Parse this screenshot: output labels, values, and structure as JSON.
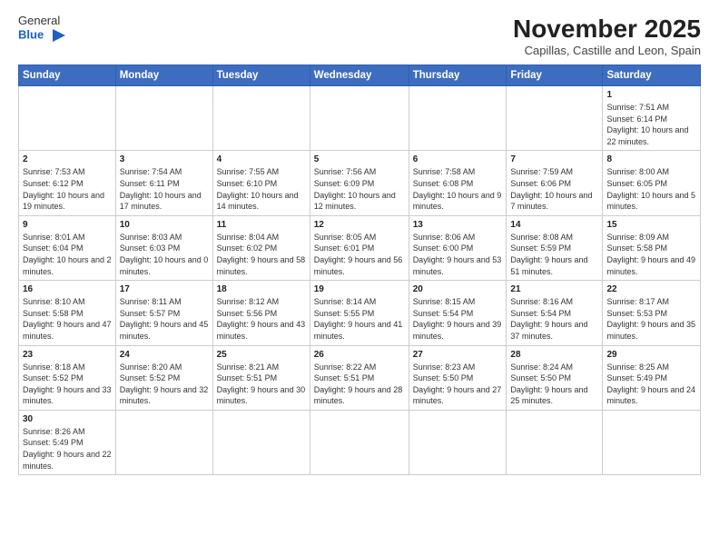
{
  "logo": {
    "text_general": "General",
    "text_blue": "Blue"
  },
  "header": {
    "month": "November 2025",
    "location": "Capillas, Castille and Leon, Spain"
  },
  "days_of_week": [
    "Sunday",
    "Monday",
    "Tuesday",
    "Wednesday",
    "Thursday",
    "Friday",
    "Saturday"
  ],
  "weeks": [
    {
      "days": [
        {
          "num": "",
          "info": ""
        },
        {
          "num": "",
          "info": ""
        },
        {
          "num": "",
          "info": ""
        },
        {
          "num": "",
          "info": ""
        },
        {
          "num": "",
          "info": ""
        },
        {
          "num": "",
          "info": ""
        },
        {
          "num": "1",
          "info": "Sunrise: 7:51 AM\nSunset: 6:14 PM\nDaylight: 10 hours and 22 minutes."
        }
      ]
    },
    {
      "days": [
        {
          "num": "2",
          "info": "Sunrise: 7:53 AM\nSunset: 6:12 PM\nDaylight: 10 hours and 19 minutes."
        },
        {
          "num": "3",
          "info": "Sunrise: 7:54 AM\nSunset: 6:11 PM\nDaylight: 10 hours and 17 minutes."
        },
        {
          "num": "4",
          "info": "Sunrise: 7:55 AM\nSunset: 6:10 PM\nDaylight: 10 hours and 14 minutes."
        },
        {
          "num": "5",
          "info": "Sunrise: 7:56 AM\nSunset: 6:09 PM\nDaylight: 10 hours and 12 minutes."
        },
        {
          "num": "6",
          "info": "Sunrise: 7:58 AM\nSunset: 6:08 PM\nDaylight: 10 hours and 9 minutes."
        },
        {
          "num": "7",
          "info": "Sunrise: 7:59 AM\nSunset: 6:06 PM\nDaylight: 10 hours and 7 minutes."
        },
        {
          "num": "8",
          "info": "Sunrise: 8:00 AM\nSunset: 6:05 PM\nDaylight: 10 hours and 5 minutes."
        }
      ]
    },
    {
      "days": [
        {
          "num": "9",
          "info": "Sunrise: 8:01 AM\nSunset: 6:04 PM\nDaylight: 10 hours and 2 minutes."
        },
        {
          "num": "10",
          "info": "Sunrise: 8:03 AM\nSunset: 6:03 PM\nDaylight: 10 hours and 0 minutes."
        },
        {
          "num": "11",
          "info": "Sunrise: 8:04 AM\nSunset: 6:02 PM\nDaylight: 9 hours and 58 minutes."
        },
        {
          "num": "12",
          "info": "Sunrise: 8:05 AM\nSunset: 6:01 PM\nDaylight: 9 hours and 56 minutes."
        },
        {
          "num": "13",
          "info": "Sunrise: 8:06 AM\nSunset: 6:00 PM\nDaylight: 9 hours and 53 minutes."
        },
        {
          "num": "14",
          "info": "Sunrise: 8:08 AM\nSunset: 5:59 PM\nDaylight: 9 hours and 51 minutes."
        },
        {
          "num": "15",
          "info": "Sunrise: 8:09 AM\nSunset: 5:58 PM\nDaylight: 9 hours and 49 minutes."
        }
      ]
    },
    {
      "days": [
        {
          "num": "16",
          "info": "Sunrise: 8:10 AM\nSunset: 5:58 PM\nDaylight: 9 hours and 47 minutes."
        },
        {
          "num": "17",
          "info": "Sunrise: 8:11 AM\nSunset: 5:57 PM\nDaylight: 9 hours and 45 minutes."
        },
        {
          "num": "18",
          "info": "Sunrise: 8:12 AM\nSunset: 5:56 PM\nDaylight: 9 hours and 43 minutes."
        },
        {
          "num": "19",
          "info": "Sunrise: 8:14 AM\nSunset: 5:55 PM\nDaylight: 9 hours and 41 minutes."
        },
        {
          "num": "20",
          "info": "Sunrise: 8:15 AM\nSunset: 5:54 PM\nDaylight: 9 hours and 39 minutes."
        },
        {
          "num": "21",
          "info": "Sunrise: 8:16 AM\nSunset: 5:54 PM\nDaylight: 9 hours and 37 minutes."
        },
        {
          "num": "22",
          "info": "Sunrise: 8:17 AM\nSunset: 5:53 PM\nDaylight: 9 hours and 35 minutes."
        }
      ]
    },
    {
      "days": [
        {
          "num": "23",
          "info": "Sunrise: 8:18 AM\nSunset: 5:52 PM\nDaylight: 9 hours and 33 minutes."
        },
        {
          "num": "24",
          "info": "Sunrise: 8:20 AM\nSunset: 5:52 PM\nDaylight: 9 hours and 32 minutes."
        },
        {
          "num": "25",
          "info": "Sunrise: 8:21 AM\nSunset: 5:51 PM\nDaylight: 9 hours and 30 minutes."
        },
        {
          "num": "26",
          "info": "Sunrise: 8:22 AM\nSunset: 5:51 PM\nDaylight: 9 hours and 28 minutes."
        },
        {
          "num": "27",
          "info": "Sunrise: 8:23 AM\nSunset: 5:50 PM\nDaylight: 9 hours and 27 minutes."
        },
        {
          "num": "28",
          "info": "Sunrise: 8:24 AM\nSunset: 5:50 PM\nDaylight: 9 hours and 25 minutes."
        },
        {
          "num": "29",
          "info": "Sunrise: 8:25 AM\nSunset: 5:49 PM\nDaylight: 9 hours and 24 minutes."
        }
      ]
    },
    {
      "days": [
        {
          "num": "30",
          "info": "Sunrise: 8:26 AM\nSunset: 5:49 PM\nDaylight: 9 hours and 22 minutes."
        },
        {
          "num": "",
          "info": ""
        },
        {
          "num": "",
          "info": ""
        },
        {
          "num": "",
          "info": ""
        },
        {
          "num": "",
          "info": ""
        },
        {
          "num": "",
          "info": ""
        },
        {
          "num": "",
          "info": ""
        }
      ]
    }
  ]
}
